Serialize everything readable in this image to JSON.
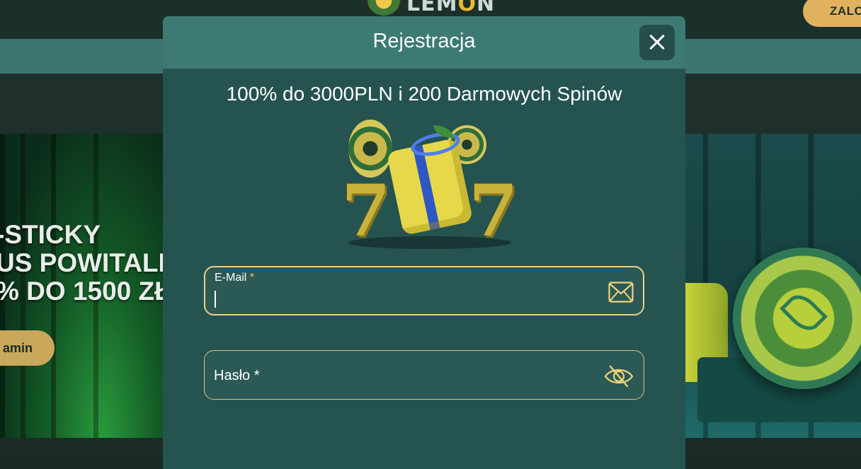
{
  "header": {
    "logo_text_prefix": "LEM",
    "logo_text_accent": "O",
    "logo_text_suffix": "N",
    "login_label": "ZALO"
  },
  "hero": {
    "line1": "-STICKY",
    "line2": "US POWITALI",
    "line3": "% DO 1500 ZŁ!",
    "cta_label": "amin"
  },
  "modal": {
    "title": "Rejestracja",
    "offer": "100% do 3000PLN i 200 Darmowych Spinów",
    "email": {
      "label": "E-Mail",
      "required_mark": "*",
      "value": "",
      "icon": "envelope-icon"
    },
    "password": {
      "label": "Hasło *",
      "value": "",
      "icon": "eye-slash-icon"
    },
    "close_icon": "close-icon"
  },
  "colors": {
    "modal_bg": "#25534f",
    "modal_header": "#3d7a74",
    "field_border": "#e8c87e",
    "accent_gold": "#e1b25e"
  }
}
